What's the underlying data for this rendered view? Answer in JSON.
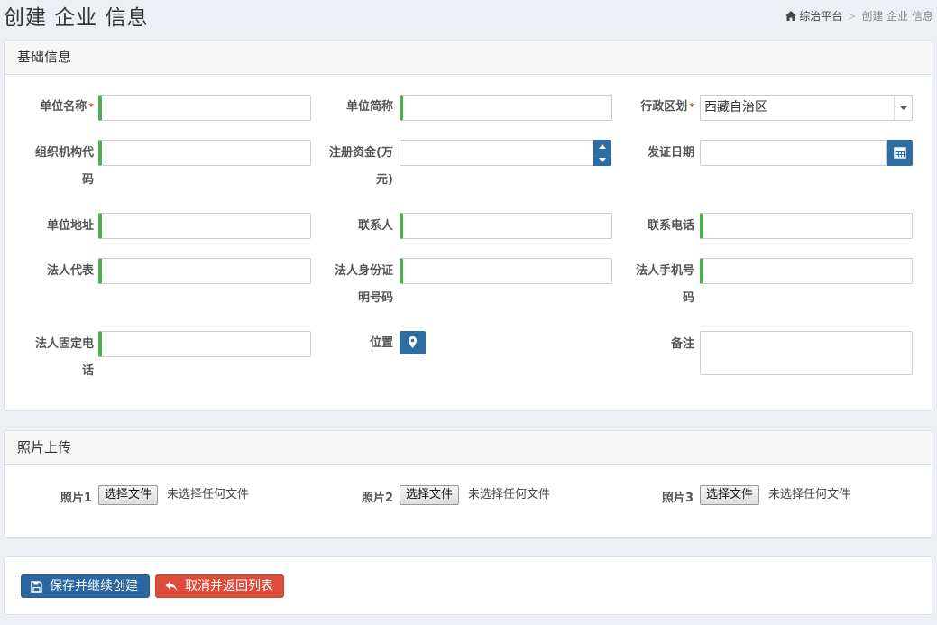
{
  "header": {
    "title": "创建 企业 信息",
    "breadcrumb": {
      "home": "综治平台",
      "separator": ">",
      "current": "创建 企业 信息"
    }
  },
  "basic": {
    "title": "基础信息",
    "fields": {
      "unit_name": {
        "label": "单位名称",
        "required": "*",
        "value": ""
      },
      "unit_short": {
        "label": "单位简称",
        "value": ""
      },
      "region": {
        "label": "行政区划",
        "required": "*",
        "value": "西藏自治区"
      },
      "org_code": {
        "label_1": "组织机构代",
        "label_2": "码",
        "value": ""
      },
      "capital": {
        "label_1": "注册资金(万",
        "label_2": "元)",
        "value": ""
      },
      "issue_date": {
        "label": "发证日期",
        "value": ""
      },
      "address": {
        "label": "单位地址",
        "value": ""
      },
      "contact": {
        "label": "联系人",
        "value": ""
      },
      "phone": {
        "label": "联系电话",
        "value": ""
      },
      "legal_rep": {
        "label": "法人代表",
        "value": ""
      },
      "legal_id": {
        "label_1": "法人身份证",
        "label_2": "明号码",
        "value": ""
      },
      "legal_mobile": {
        "label_1": "法人手机号",
        "label_2": "码",
        "value": ""
      },
      "legal_tel": {
        "label_1": "法人固定电",
        "label_2": "话",
        "value": ""
      },
      "location": {
        "label": "位置"
      },
      "notes": {
        "label": "备注",
        "value": ""
      }
    }
  },
  "photos": {
    "title": "照片上传",
    "choose_label": "选择文件",
    "no_file": "未选择任何文件",
    "items": [
      {
        "label": "照片1"
      },
      {
        "label": "照片2"
      },
      {
        "label": "照片3"
      }
    ]
  },
  "actions": {
    "save": "保存并继续创建",
    "cancel": "取消并返回列表"
  },
  "colors": {
    "primary": "#2a67a3",
    "danger": "#dd4b39",
    "valid": "#4cae4c",
    "background": "#ecf0f5"
  }
}
